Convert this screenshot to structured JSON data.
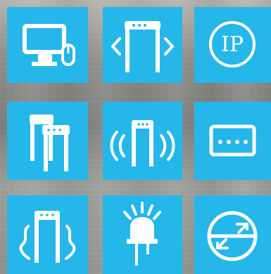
{
  "tiles": [
    {
      "name": "monitor-icon"
    },
    {
      "name": "metal-detector-scan-icon"
    },
    {
      "name": "ip-icon",
      "label": "IP"
    },
    {
      "name": "multiple-gates-icon"
    },
    {
      "name": "signal-gate-icon"
    },
    {
      "name": "display-panel-icon"
    },
    {
      "name": "vibration-gate-icon"
    },
    {
      "name": "led-icon"
    },
    {
      "name": "connection-exchange-icon"
    }
  ],
  "colors": {
    "tile": "#25b6ea",
    "icon": "#ffffff"
  }
}
